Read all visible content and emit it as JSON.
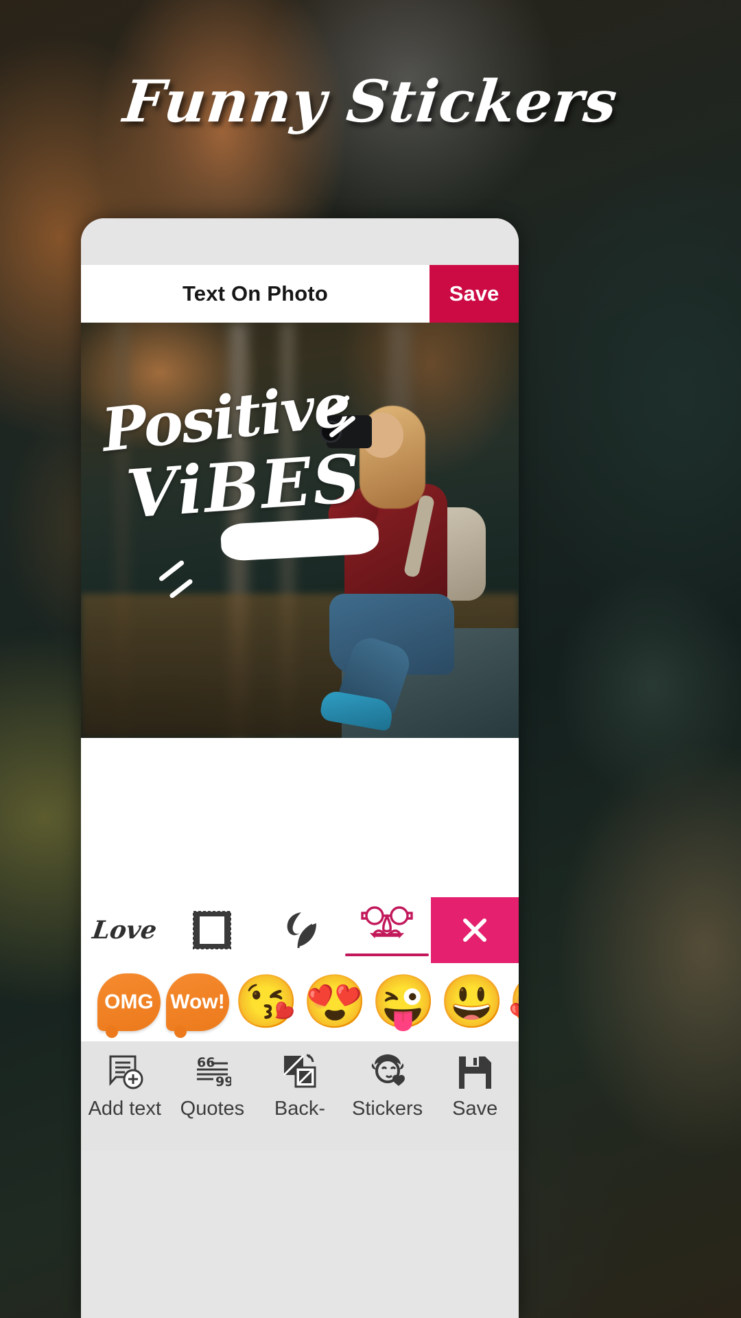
{
  "title": "Funny Stickers",
  "appbar": {
    "title": "Text On Photo",
    "save_label": "Save",
    "save_color": "#cc0a44"
  },
  "canvas": {
    "overlay_line1": "Positive",
    "overlay_line2": "ViBES",
    "photo_alt": "woman-with-camera-in-autumn-forest"
  },
  "categories": {
    "accent_color": "#c2185b",
    "close_color": "#e5206e",
    "items": [
      {
        "id": "love",
        "label": "Love",
        "icon": "love-script-icon",
        "active": false
      },
      {
        "id": "frames",
        "label": "Frames",
        "icon": "stamp-frame-icon",
        "active": false
      },
      {
        "id": "nature",
        "label": "Nature",
        "icon": "leaf-icon",
        "active": false
      },
      {
        "id": "funny",
        "label": "Funny",
        "icon": "funny-glasses-icon",
        "active": true
      }
    ],
    "close_icon": "close-icon"
  },
  "stickers": [
    {
      "id": "omg",
      "type": "bubble",
      "label": "OMG",
      "icon": "omg-bubble-sticker"
    },
    {
      "id": "wow",
      "type": "bubble",
      "label": "Wow!",
      "icon": "wow-bubble-sticker"
    },
    {
      "id": "kiss",
      "type": "emoji",
      "label": "😘",
      "icon": "kissing-heart-emoji"
    },
    {
      "id": "hearteyes",
      "type": "emoji",
      "label": "😍",
      "icon": "heart-eyes-emoji"
    },
    {
      "id": "wink",
      "type": "emoji",
      "label": "😜",
      "icon": "winking-tongue-emoji"
    },
    {
      "id": "grin",
      "type": "emoji",
      "label": "😃",
      "icon": "grinning-big-eyes-emoji"
    },
    {
      "id": "hugheart",
      "type": "emoji",
      "label": "🥰",
      "icon": "smiling-hearts-emoji"
    }
  ],
  "bottom_nav": [
    {
      "id": "add-text",
      "label": "Add text",
      "icon": "add-text-icon"
    },
    {
      "id": "quotes",
      "label": "Quotes",
      "icon": "quotes-icon"
    },
    {
      "id": "background",
      "label": "Back-",
      "icon": "background-icon"
    },
    {
      "id": "stickers",
      "label": "Stickers",
      "icon": "sticker-face-icon"
    },
    {
      "id": "save",
      "label": "Save",
      "icon": "save-disk-icon"
    }
  ]
}
